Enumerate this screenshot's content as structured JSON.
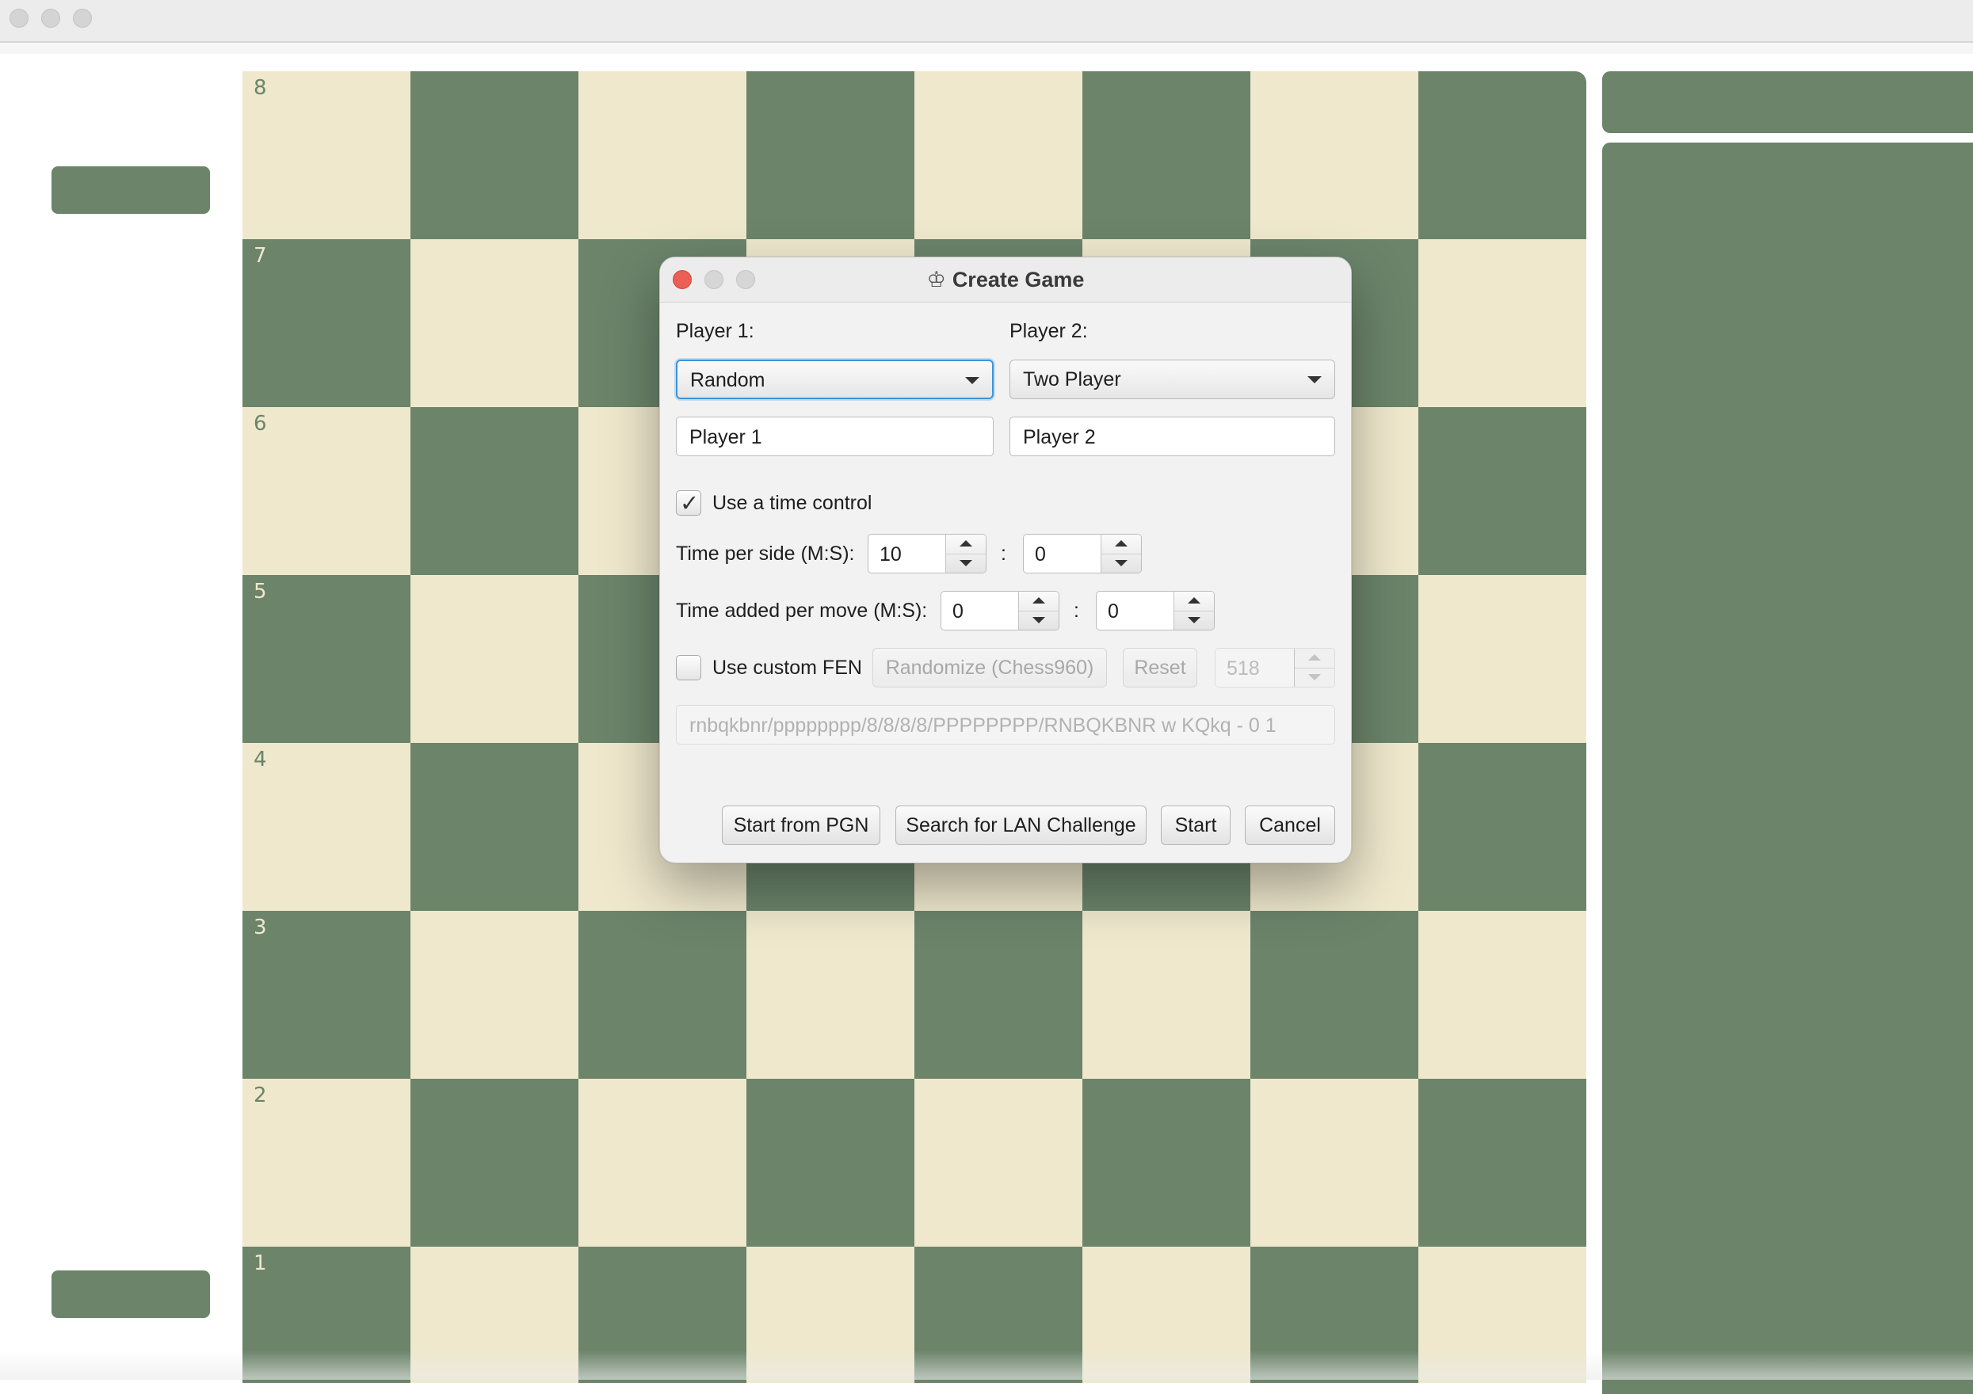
{
  "board": {
    "light_color": "#efe8cd",
    "dark_color": "#6b846a",
    "rank_labels": [
      "8",
      "7",
      "6",
      "5",
      "4",
      "3",
      "2",
      "1"
    ]
  },
  "dialog": {
    "title": "Create Game",
    "title_icon": "white-king-icon",
    "player1": {
      "label": "Player 1:",
      "type_value": "Random",
      "name_value": "Player 1"
    },
    "player2": {
      "label": "Player 2:",
      "type_value": "Two Player",
      "name_value": "Player 2"
    },
    "time_control": {
      "enabled": true,
      "label": "Use a time control",
      "time_per_side_label": "Time per side (M:S):",
      "minutes": "10",
      "seconds": "0",
      "increment_label": "Time added per move (M:S):",
      "increment_minutes": "0",
      "increment_seconds": "0",
      "separator": ":"
    },
    "fen": {
      "enabled": false,
      "label": "Use custom FEN",
      "randomize_label": "Randomize (Chess960)",
      "reset_label": "Reset",
      "position_number": "518",
      "value": "rnbqkbnr/pppppppp/8/8/8/8/PPPPPPPP/RNBQKBNR w KQkq - 0 1"
    },
    "buttons": {
      "start_from_pgn": "Start from PGN",
      "search_lan": "Search for LAN Challenge",
      "start": "Start",
      "cancel": "Cancel"
    }
  }
}
